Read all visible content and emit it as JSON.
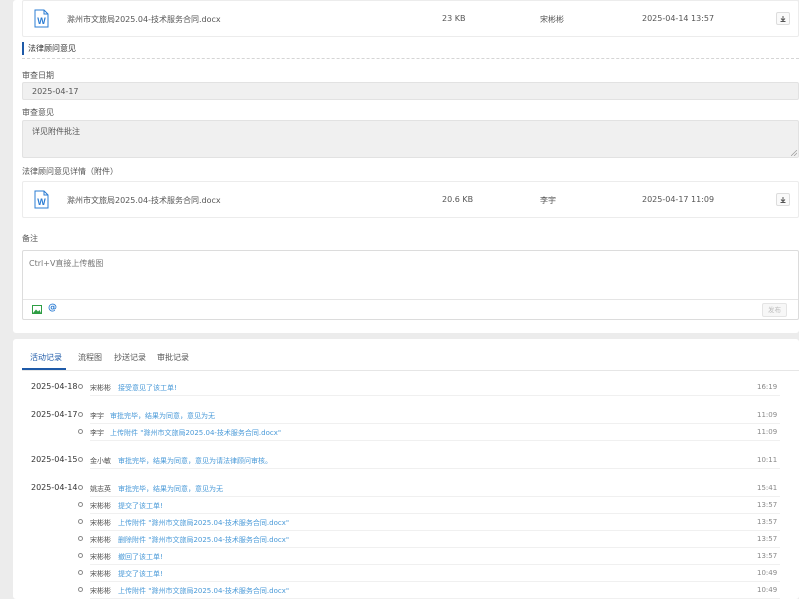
{
  "attachments_top": {
    "file_name": "滁州市文旅局2025.04-技术服务合同.docx",
    "size": "23 KB",
    "uploader": "宋彬彬",
    "time": "2025-04-14 13:57"
  },
  "legal_section": {
    "title": "法律顾问意见",
    "review_date_label": "审查日期",
    "review_date_value": "2025-04-17",
    "review_opinion_label": "审查意见",
    "review_opinion_value": "详见附件批注",
    "attachment_label": "法律顾问意见详情（附件）",
    "attachment": {
      "file_name": "滁州市文旅局2025.04-技术服务合同.docx",
      "size": "20.6 KB",
      "uploader": "李宇",
      "time": "2025-04-17 11:09"
    }
  },
  "notes": {
    "label": "备注",
    "placeholder": "Ctrl+V直接上传截图",
    "send_label": "发布"
  },
  "log": {
    "tabs": [
      "活动记录",
      "流程图",
      "抄送记录",
      "审批记录"
    ],
    "groups": [
      {
        "date": "2025-04-18",
        "entries": [
          {
            "user": "宋彬彬",
            "action": "接受意见了该工单!",
            "time": "16:19"
          }
        ]
      },
      {
        "date": "2025-04-17",
        "entries": [
          {
            "user": "李宇",
            "action": "审批完毕，结果为同意，意见为无",
            "time": "11:09"
          },
          {
            "user": "李宇",
            "action": "上传附件 \"滁州市文旅局2025.04-技术服务合同.docx\"",
            "time": "11:09"
          }
        ]
      },
      {
        "date": "2025-04-15",
        "entries": [
          {
            "user": "金小敏",
            "action": "审批完毕，结果为同意，意见为请法律顾问审核。",
            "time": "10:11"
          }
        ]
      },
      {
        "date": "2025-04-14",
        "entries": [
          {
            "user": "姚志英",
            "action": "审批完毕，结果为同意，意见为无",
            "time": "15:41"
          },
          {
            "user": "宋彬彬",
            "action": "提交了该工单!",
            "time": "13:57"
          },
          {
            "user": "宋彬彬",
            "action": "上传附件 \"滁州市文旅局2025.04-技术服务合同.docx\"",
            "time": "13:57"
          },
          {
            "user": "宋彬彬",
            "action": "删除附件 \"滁州市文旅局2025.04-技术服务合同.docx\"",
            "time": "13:57"
          },
          {
            "user": "宋彬彬",
            "action": "撤回了该工单!",
            "time": "13:57"
          },
          {
            "user": "宋彬彬",
            "action": "提交了该工单!",
            "time": "10:49"
          },
          {
            "user": "宋彬彬",
            "action": "上传附件 \"滁州市文旅局2025.04-技术服务合同.docx\"",
            "time": "10:49"
          }
        ]
      }
    ]
  },
  "icons": {
    "file": "word-doc-icon",
    "download": "download-icon",
    "image": "image-upload-icon",
    "mention": "at-mention-icon"
  },
  "colors": {
    "accent": "#1e5aa8",
    "link": "#4a9ad8"
  }
}
